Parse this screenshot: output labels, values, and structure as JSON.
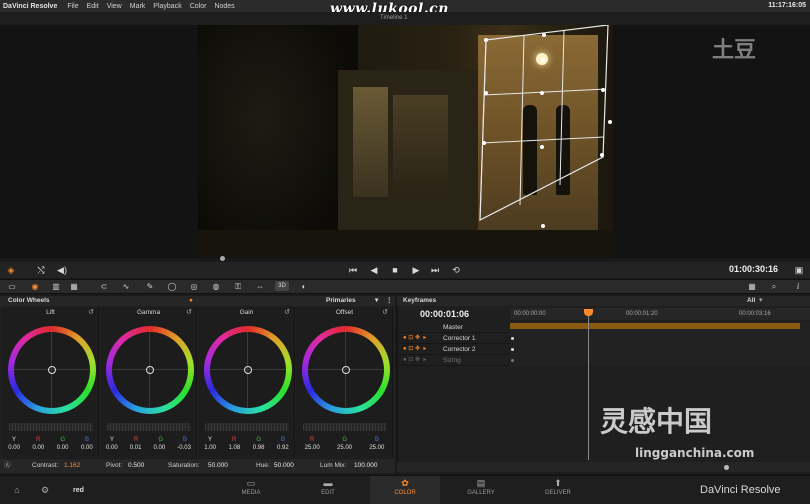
{
  "menubar": {
    "app": "DaVinci Resolve",
    "items": [
      "File",
      "Edit",
      "View",
      "Mark",
      "Playback",
      "Color",
      "Nodes"
    ],
    "clock": "11:17:16:05"
  },
  "watermark_top": "www.lukool.cn",
  "watermark_tudou": "土豆",
  "viewer": {
    "timeline_name": "Timeline 1"
  },
  "transport": {
    "timecode": "01:00:30:16"
  },
  "toolbar": {
    "badge_3d": "3D"
  },
  "color_wheels": {
    "header": "Color Wheels",
    "mode": "Primaries",
    "wheels": [
      {
        "title": "Lift",
        "labels": [
          "Y",
          "R",
          "G",
          "B"
        ],
        "values": [
          "0.00",
          "0.00",
          "0.00",
          "0.00"
        ]
      },
      {
        "title": "Gamma",
        "labels": [
          "Y",
          "R",
          "G",
          "B"
        ],
        "values": [
          "0.00",
          "0.01",
          "0.00",
          "-0.03"
        ]
      },
      {
        "title": "Gain",
        "labels": [
          "Y",
          "R",
          "G",
          "B"
        ],
        "values": [
          "1.00",
          "1.08",
          "0.98",
          "0.92"
        ]
      },
      {
        "title": "Offset",
        "labels": [
          "R",
          "G",
          "B"
        ],
        "values": [
          "25.00",
          "25.00",
          "25.00"
        ]
      }
    ]
  },
  "params": {
    "contrast_label": "Contrast:",
    "contrast": "1.162",
    "pivot_label": "Pivot:",
    "pivot": "0.500",
    "saturation_label": "Saturation:",
    "saturation": "50.000",
    "hue_label": "Hue:",
    "hue": "50.000",
    "lummix_label": "Lum Mix:",
    "lummix": "100.000"
  },
  "keyframes": {
    "header": "Keyframes",
    "filter": "All",
    "timecode": "00:00:01:06",
    "ruler": [
      "00:00:00:00",
      "00:00:01:20",
      "00:00:03:16"
    ],
    "rows": [
      "Master",
      "Corrector 1",
      "Corrector 2",
      "Sizing"
    ]
  },
  "pagebar": {
    "clip_label": "red",
    "pages": [
      "MEDIA",
      "EDIT",
      "COLOR",
      "GALLERY",
      "DELIVER"
    ],
    "active_page": "COLOR",
    "brand": "DaVinci Resolve"
  },
  "watermark_bottom": "灵感中国",
  "watermark_bottom_sub": "lingganchina.com",
  "colors": {
    "accent": "#ff8a2b",
    "keyframe_bar": "#8a5a10"
  }
}
